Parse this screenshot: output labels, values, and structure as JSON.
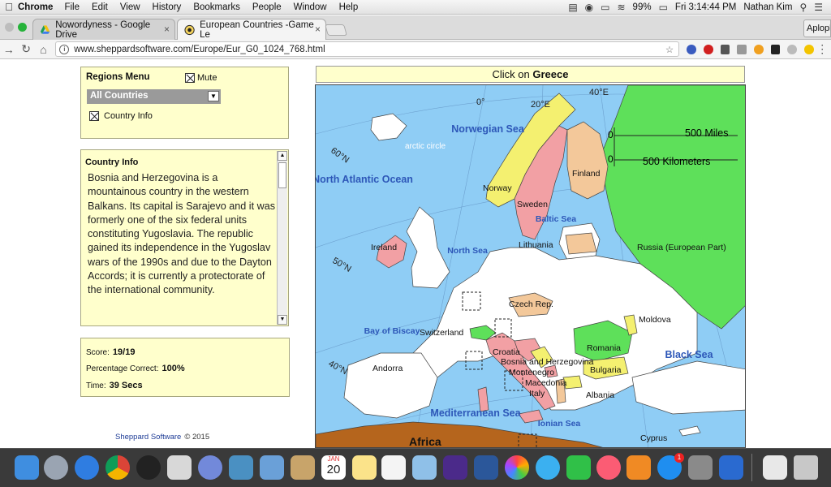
{
  "menubar": {
    "app": "Chrome",
    "items": [
      "File",
      "Edit",
      "View",
      "History",
      "Bookmarks",
      "People",
      "Window",
      "Help"
    ],
    "battery": "99%",
    "clock": "Fri 3:14:44 PM",
    "user": "Nathan Kim"
  },
  "tabs": [
    {
      "title": "Nowordyness - Google Drive"
    },
    {
      "title": "European Countries -Game Le"
    }
  ],
  "profile_chip": "Aplopl",
  "address": {
    "url": "www.sheppardsoftware.com/Europe/Eur_G0_1024_768.html"
  },
  "regions_menu": {
    "title": "Regions Menu",
    "mute_label": "Mute",
    "selected_region": "All Countries",
    "country_info_label": "Country Info"
  },
  "country_info": {
    "title": "Country Info",
    "text": "Bosnia and Herzegovina is a mountainous country in the western Balkans. Its capital is Sarajevo and it was formerly one of the six federal units constituting Yugoslavia. The republic gained its independence in the Yugoslav wars of the 1990s and due to the Dayton Accords; it is currently a protectorate of the international community."
  },
  "score": {
    "score_label": "Score:",
    "score_value": "19/19",
    "pct_label": "Percentage Correct:",
    "pct_value": "100%",
    "time_label": "Time:",
    "time_value": "39 Secs"
  },
  "credit": {
    "name": "Sheppard Software",
    "copyright": "© 2015"
  },
  "prompt": {
    "prefix": "Click on",
    "target": "Greece"
  },
  "map": {
    "water_labels": [
      "Norwegian Sea",
      "North Atlantic Ocean",
      "Baltic Sea",
      "North Sea",
      "Bay of Biscay",
      "Mediterranean Sea",
      "Black Sea",
      "Ionian Sea"
    ],
    "arctic_circle": "arctic circle",
    "scale_miles": "500 Miles",
    "scale_km": "500 Kilometers",
    "scale_zero": "0",
    "graticule": [
      "0°",
      "20°E",
      "40°E",
      "60°N",
      "50°N",
      "40°N"
    ],
    "country_labels": [
      "Norway",
      "Sweden",
      "Finland",
      "Ireland",
      "Lithuania",
      "Russia (European Part)",
      "Czech Rep.",
      "Moldova",
      "Switzerland",
      "Romania",
      "Croatia",
      "Bosnia and Herzegovina",
      "Montenegro",
      "Bulgaria",
      "Macedonia",
      "Italy",
      "Albania",
      "Andorra",
      "Cyprus"
    ],
    "continent_label": "Africa",
    "colors": {
      "water": "#8fcdf5",
      "land": "#ffffff",
      "green": "#5ee05a",
      "pink": "#f2a0a4",
      "tan": "#f3c89a",
      "yellow": "#f4f070",
      "africa": "#b5651d"
    }
  },
  "dock": {
    "calendar_day": "20",
    "calendar_month": "JAN",
    "badge": "1"
  }
}
